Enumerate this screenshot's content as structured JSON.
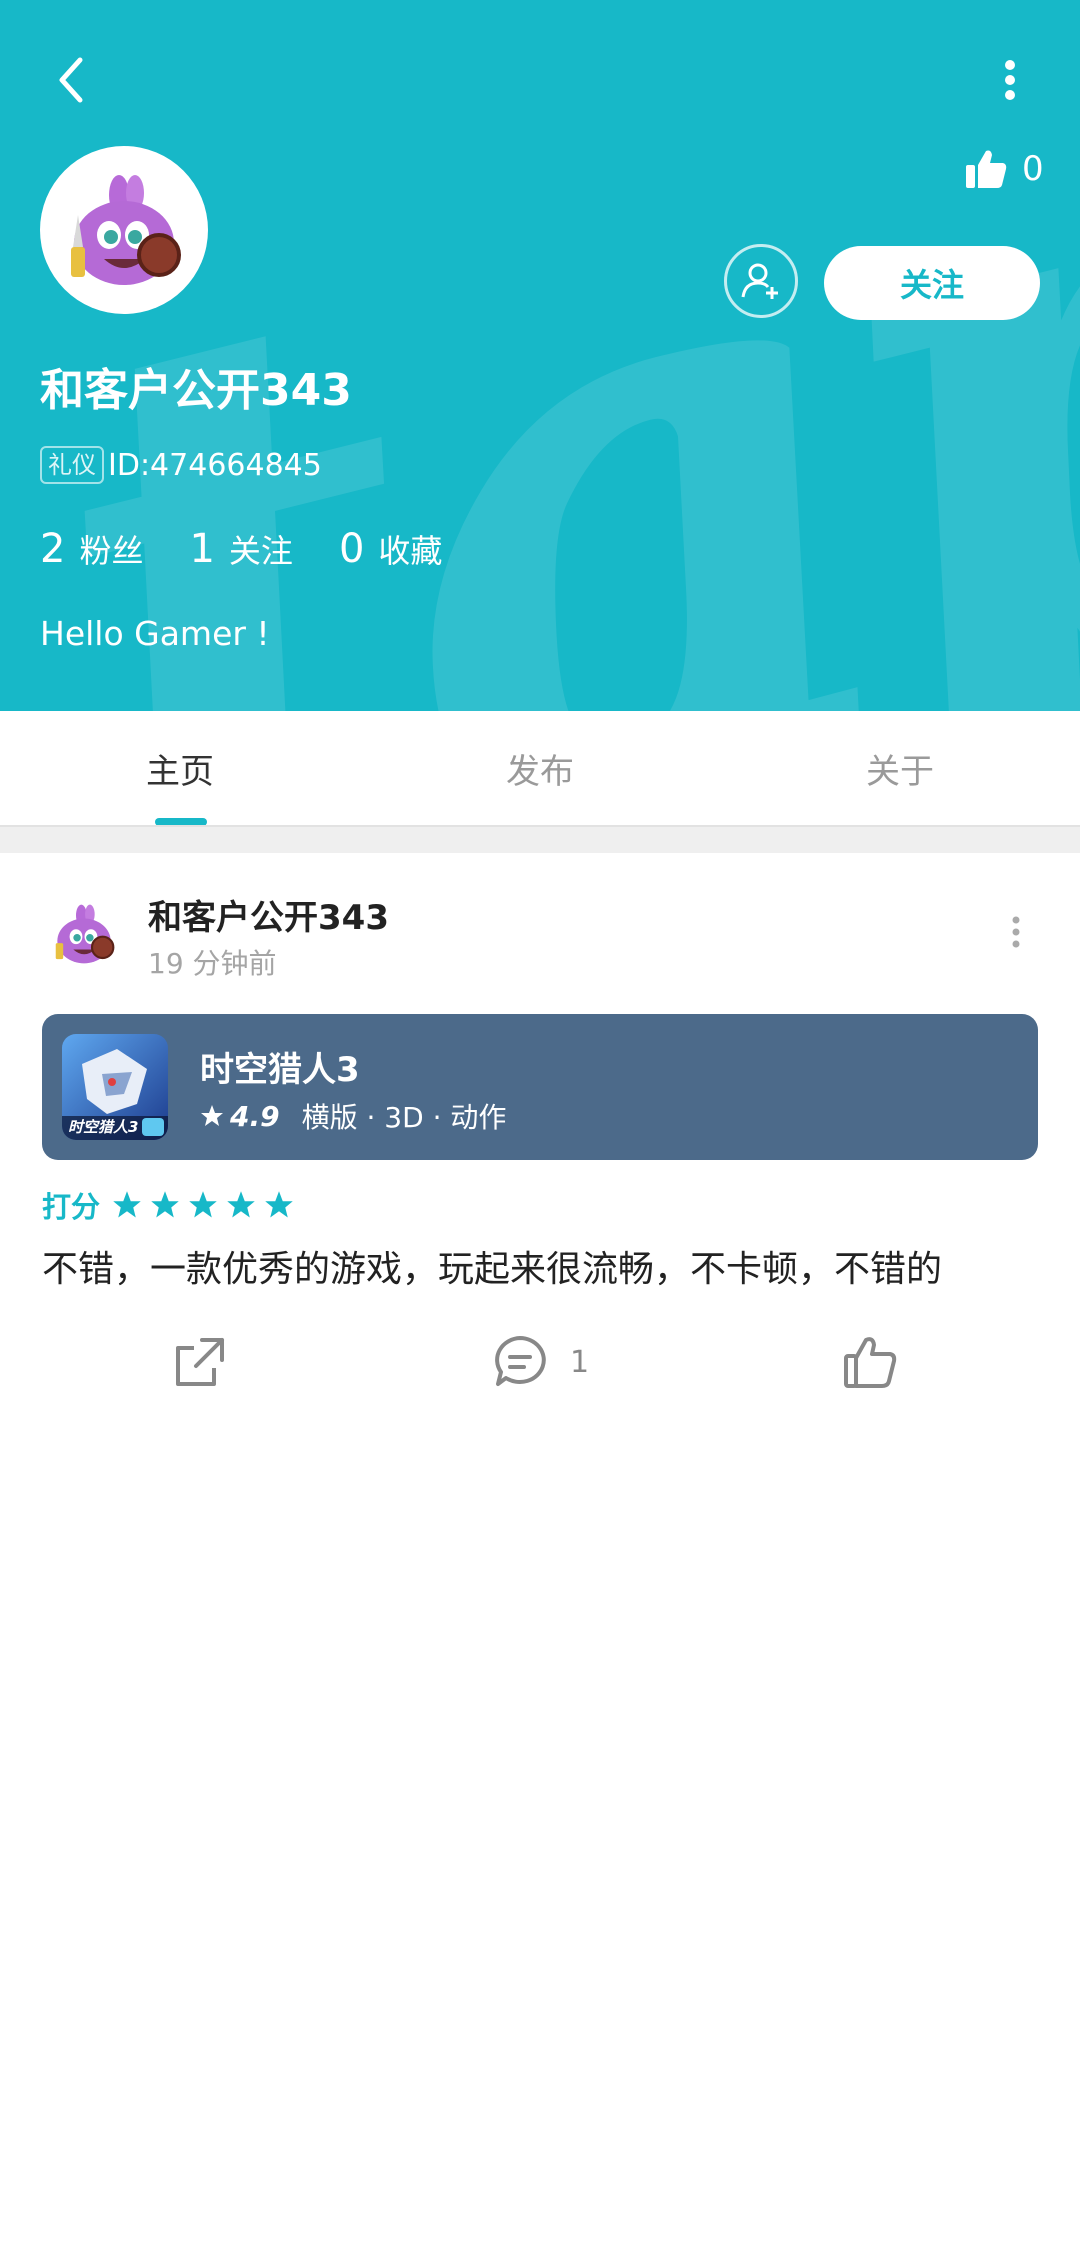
{
  "header": {
    "like_count": "0",
    "follow_label": "关注",
    "username": "和客户公开343",
    "badge": "礼仪",
    "user_id": "ID:474664845",
    "stats": [
      {
        "num": "2",
        "label": "粉丝"
      },
      {
        "num": "1",
        "label": "关注"
      },
      {
        "num": "0",
        "label": "收藏"
      }
    ],
    "bio": "Hello Gamer !",
    "bg_color": "#17b8c8"
  },
  "tabs": [
    {
      "label": "主页",
      "active": true
    },
    {
      "label": "发布",
      "active": false
    },
    {
      "label": "关于",
      "active": false
    }
  ],
  "post": {
    "author": "和客户公开343",
    "time": "19 分钟前",
    "game": {
      "name": "时空猎人3",
      "rating": "4.9",
      "tags": "横版 · 3D · 动作",
      "icon_caption": "时空猎人3",
      "card_color": "#4c6a8a"
    },
    "rating_label": "打分",
    "stars": 5,
    "text": "不错，一款优秀的游戏，玩起来很流畅，不卡顿，不错的",
    "comment_count": "1"
  },
  "icons": [
    "back-arrow-icon",
    "more-vertical-icon",
    "thumbs-up-icon",
    "add-user-icon",
    "star-icon",
    "share-icon",
    "comment-icon",
    "like-icon"
  ]
}
